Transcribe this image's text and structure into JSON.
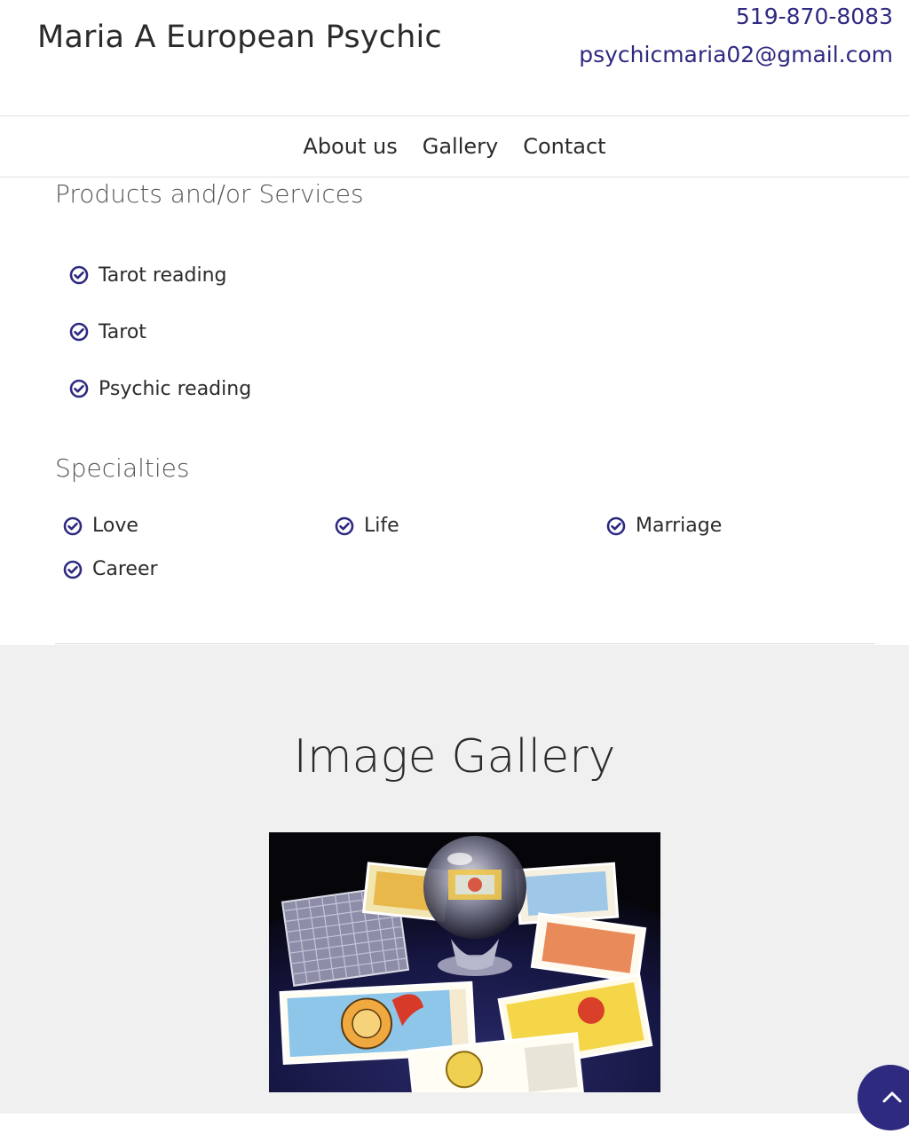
{
  "header": {
    "title": "Maria A European Psychic",
    "phone": "519-870-8083",
    "email": "psychicmaria02@gmail.com"
  },
  "nav": {
    "items": [
      "About us",
      "Gallery",
      "Contact"
    ]
  },
  "services": {
    "heading": "Products and/or Services",
    "items": [
      "Tarot reading",
      "Tarot",
      "Psychic reading"
    ]
  },
  "specialties": {
    "heading": "Specialties",
    "items": [
      "Love",
      "Life",
      "Marriage",
      "Career"
    ]
  },
  "gallery": {
    "heading": "Image Gallery"
  },
  "icons": {
    "check": "check-circle-icon",
    "back_to_top": "chevron-up-icon"
  },
  "colors": {
    "accent": "#2e2a80",
    "gallery_bg": "#f0f0f0"
  }
}
